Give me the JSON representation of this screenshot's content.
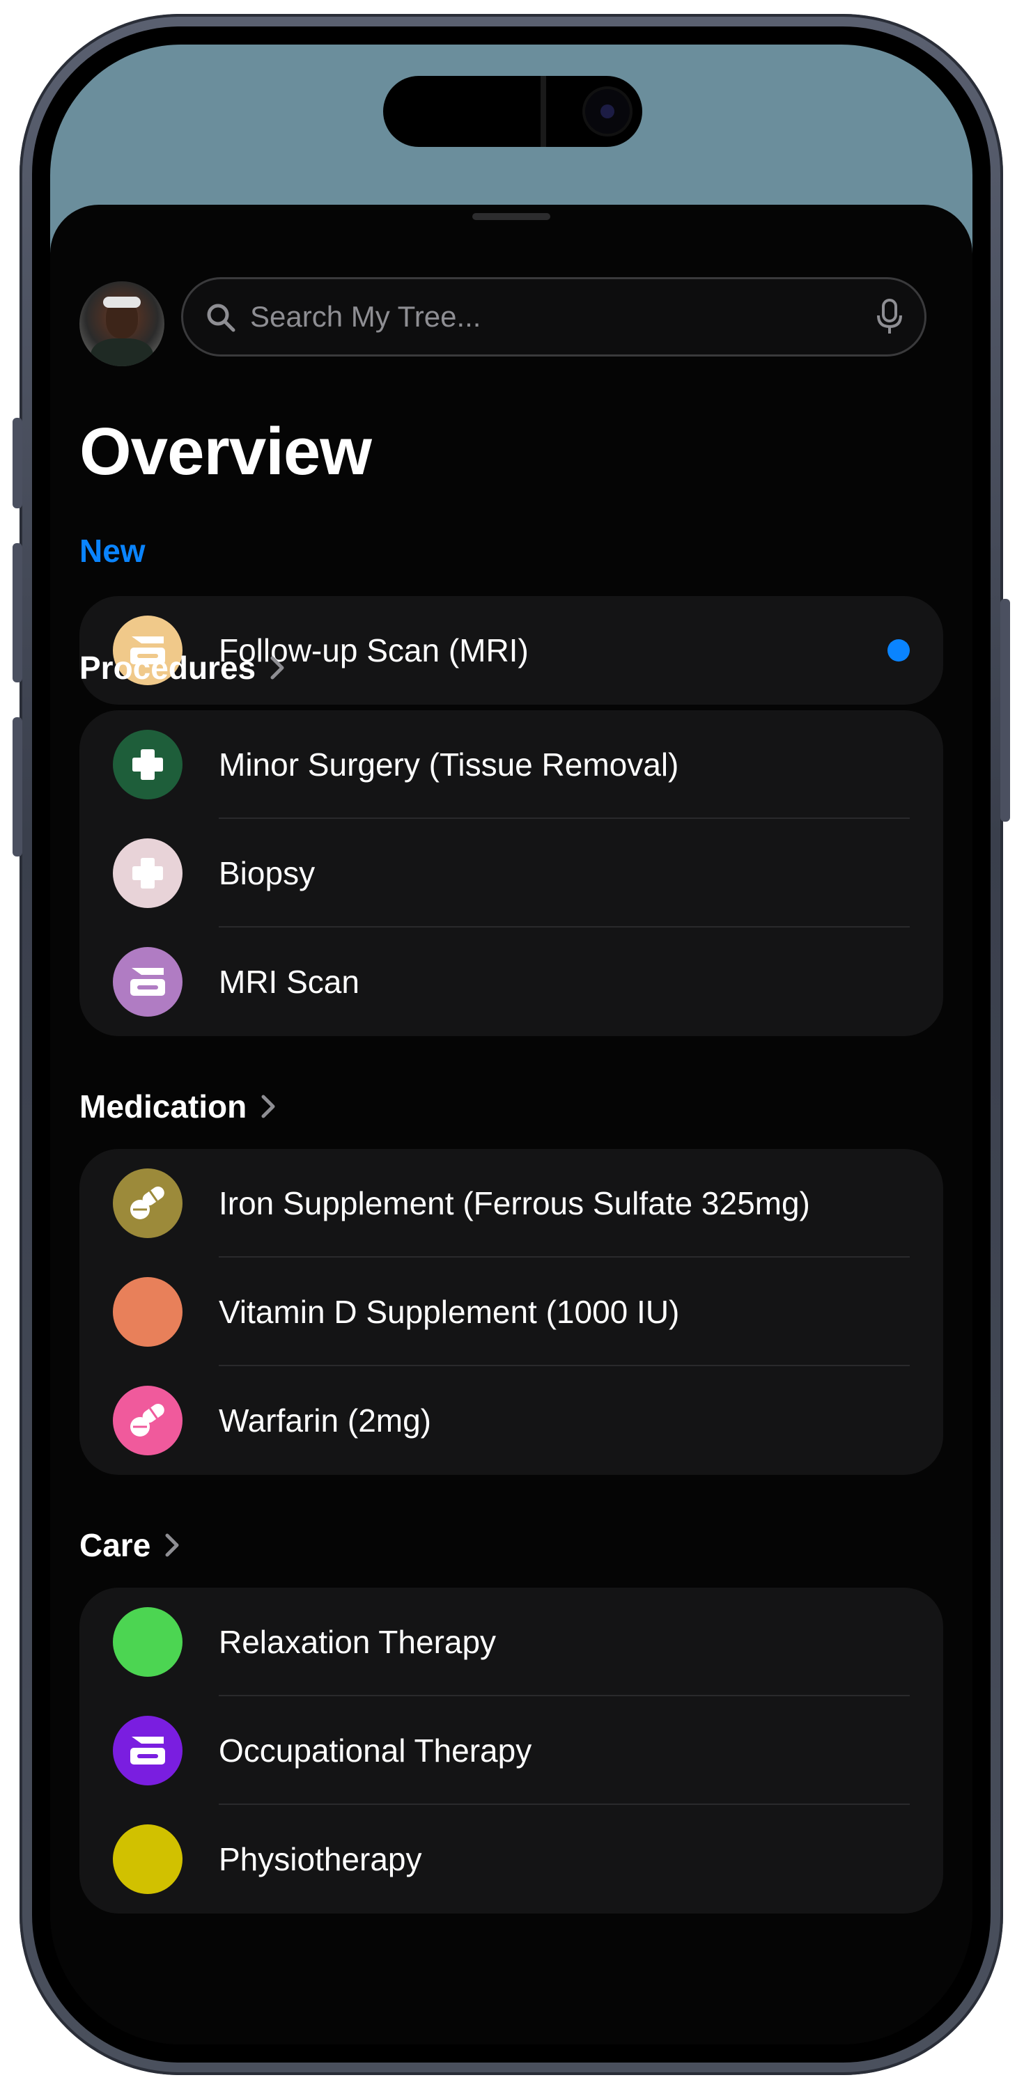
{
  "search": {
    "placeholder": "Search My Tree..."
  },
  "page": {
    "title": "Overview"
  },
  "sections": {
    "new": {
      "label": "New",
      "items": [
        {
          "label": "Follow-up Scan (MRI)",
          "icon": "scanner-icon",
          "color": "#f0c98a",
          "unread": true
        }
      ]
    },
    "procedures": {
      "label": "Procedures",
      "items": [
        {
          "label": "Minor Surgery (Tissue Removal)",
          "icon": "medical-cross-icon",
          "color": "#1e5e3a"
        },
        {
          "label": "Biopsy",
          "icon": "medical-cross-icon",
          "color": "#e8d3d8"
        },
        {
          "label": "MRI Scan",
          "icon": "scanner-icon",
          "color": "#b07cc3"
        }
      ]
    },
    "medication": {
      "label": "Medication",
      "items": [
        {
          "label": "Iron Supplement (Ferrous Sulfate 325mg)",
          "icon": "pills-icon",
          "color": "#9c8a3a"
        },
        {
          "label": "Vitamin D Supplement (1000 IU)",
          "icon": "circle-icon",
          "color": "#e8805a"
        },
        {
          "label": "Warfarin (2mg)",
          "icon": "pills-icon",
          "color": "#f05a9c"
        }
      ]
    },
    "care": {
      "label": "Care",
      "items": [
        {
          "label": "Relaxation Therapy",
          "icon": "circle-icon",
          "color": "#4cd552"
        },
        {
          "label": "Occupational Therapy",
          "icon": "scanner-icon",
          "color": "#7a1ee0"
        },
        {
          "label": "Physiotherapy",
          "icon": "circle-icon",
          "color": "#d1c100"
        }
      ]
    }
  }
}
